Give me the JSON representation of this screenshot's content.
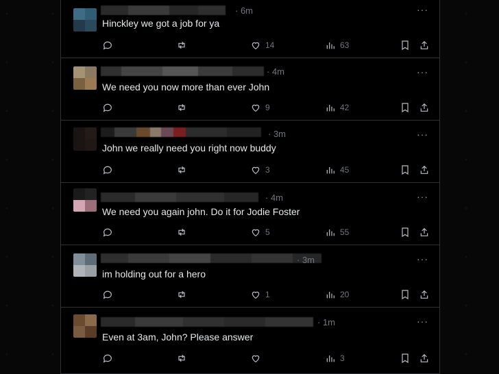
{
  "tweets": [
    {
      "time": "6m",
      "text": "Hinckley we got a job for ya",
      "likes": "14",
      "views": "63",
      "avatar": [
        "#3d6d86",
        "#2f5d74",
        "#223a4a",
        "#2a4a5c"
      ]
    },
    {
      "time": "4m",
      "text": "We need you now more than ever John",
      "likes": "9",
      "views": "42",
      "avatar": [
        "#a59273",
        "#8a7a5f",
        "#7a6040",
        "#9a7a55"
      ]
    },
    {
      "time": "3m",
      "text": "John we really need you right now buddy",
      "likes": "3",
      "views": "45",
      "avatar": [
        "#1a1412",
        "#241a16",
        "#1a1412",
        "#201814"
      ]
    },
    {
      "time": "4m",
      "text": "We need you again john. Do it for Jodie Foster",
      "likes": "5",
      "views": "55",
      "avatar": [
        "#1a1a1a",
        "#222",
        "#d4a6b3",
        "#9a6f7a"
      ]
    },
    {
      "time": "3m",
      "text": "im holding out for a hero",
      "likes": "1",
      "views": "20",
      "avatar": [
        "#7f8e98",
        "#5d6d78",
        "#b0b4b8",
        "#9aa0a6"
      ]
    },
    {
      "time": "1m",
      "text": "Even at 3am, John? Please answer",
      "likes": "",
      "views": "3",
      "avatar": [
        "#6a4a30",
        "#8a6a4a",
        "#7a5a40",
        "#5a3d28"
      ]
    }
  ],
  "more_label": "···"
}
